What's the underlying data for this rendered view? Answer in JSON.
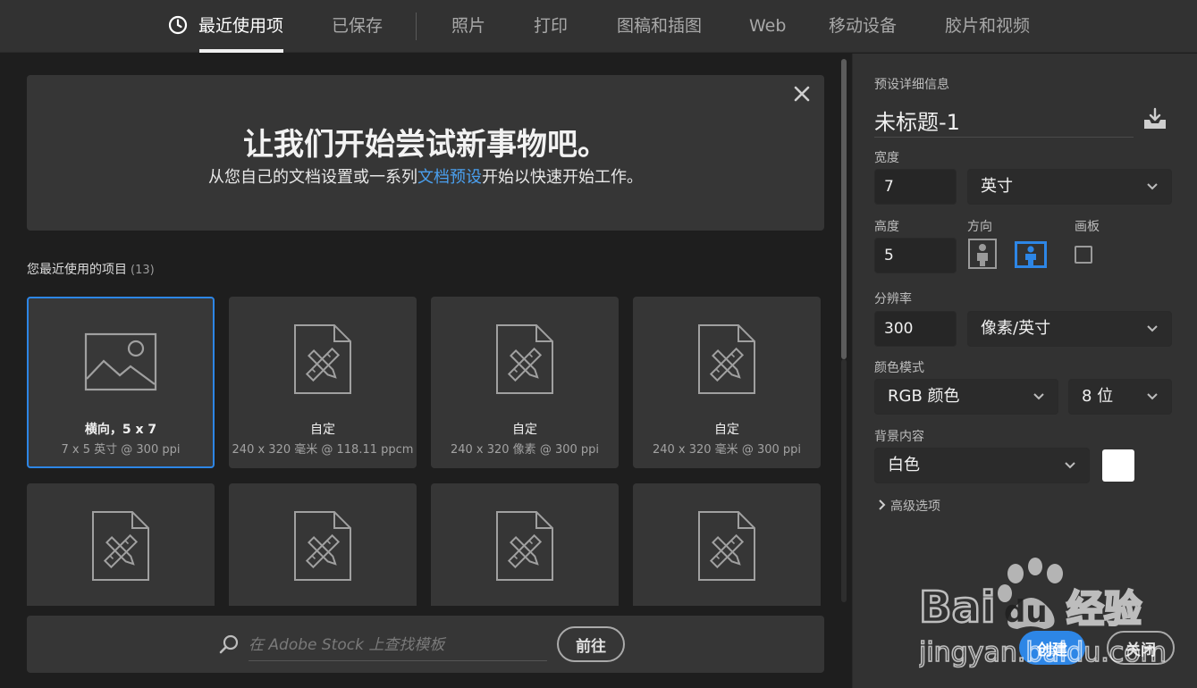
{
  "tabs": [
    {
      "label": "最近使用项",
      "active": true
    },
    {
      "label": "已保存",
      "active": false
    },
    {
      "label": "照片",
      "active": false
    },
    {
      "label": "打印",
      "active": false
    },
    {
      "label": "图稿和插图",
      "active": false
    },
    {
      "label": "Web",
      "active": false
    },
    {
      "label": "移动设备",
      "active": false
    },
    {
      "label": "胶片和视频",
      "active": false
    }
  ],
  "banner": {
    "title": "让我们开始尝试新事物吧。",
    "subtitle_before": "从您自己的文档设置或一系列",
    "subtitle_link": "文档预设",
    "subtitle_after": "开始以快速开始工作。",
    "close_icon": "close-icon"
  },
  "recent": {
    "header": "您最近使用的项目",
    "count": "(13)",
    "items": [
      {
        "name": "横向，5 x 7",
        "meta": "7 x 5 英寸 @ 300 ppi",
        "icon": "image-icon",
        "selected": true
      },
      {
        "name": "自定",
        "meta": "240 x 320 毫米 @ 118.11 ppcm",
        "icon": "document-icon",
        "selected": false
      },
      {
        "name": "自定",
        "meta": "240 x 320 像素 @ 300 ppi",
        "icon": "document-icon",
        "selected": false
      },
      {
        "name": "自定",
        "meta": "240 x 320 毫米 @ 300 ppi",
        "icon": "document-icon",
        "selected": false
      },
      {
        "name": "",
        "meta": "",
        "icon": "document-icon",
        "selected": false
      },
      {
        "name": "",
        "meta": "",
        "icon": "document-icon",
        "selected": false
      },
      {
        "name": "",
        "meta": "",
        "icon": "document-icon",
        "selected": false
      },
      {
        "name": "",
        "meta": "",
        "icon": "document-icon",
        "selected": false
      }
    ]
  },
  "stock": {
    "placeholder": "在 Adobe Stock 上查找模板",
    "go_label": "前往"
  },
  "preset": {
    "section_label": "预设详细信息",
    "title": "未标题-1",
    "width_label": "宽度",
    "width_value": "7",
    "width_unit": "英寸",
    "height_label": "高度",
    "height_value": "5",
    "orientation_label": "方向",
    "orientation_selected": "landscape",
    "artboard_label": "画板",
    "artboard_checked": false,
    "resolution_label": "分辨率",
    "resolution_value": "300",
    "resolution_unit": "像素/英寸",
    "color_mode_label": "颜色模式",
    "color_mode_value": "RGB 颜色",
    "bit_depth_value": "8 位",
    "background_label": "背景内容",
    "background_value": "白色",
    "background_color": "#ffffff",
    "advanced_label": "高级选项"
  },
  "actions": {
    "create_label": "创建",
    "close_label": "关闭"
  },
  "watermark": {
    "brand_text": "Baidu经验",
    "url_text": "jingyan.baidu.com"
  },
  "colors": {
    "accent": "#2d86e6",
    "link": "#4aa0f0"
  }
}
